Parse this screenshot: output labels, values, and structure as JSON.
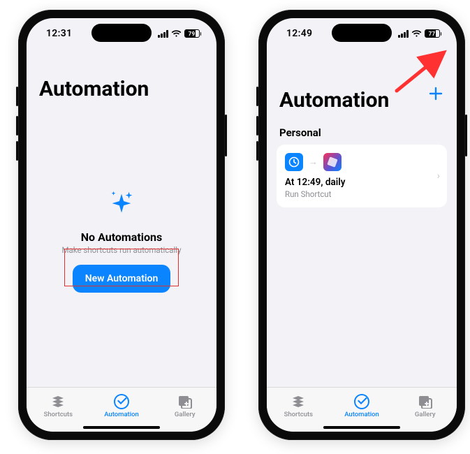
{
  "left": {
    "status": {
      "time": "12:31",
      "battery": "79"
    },
    "title": "Automation",
    "empty": {
      "heading": "No Automations",
      "subtitle": "Make shortcuts run automatically",
      "button": "New Automation"
    }
  },
  "right": {
    "status": {
      "time": "12:49",
      "battery": "77"
    },
    "title": "Automation",
    "section": "Personal",
    "automation": {
      "title": "At 12:49, daily",
      "subtitle": "Run Shortcut"
    }
  },
  "tabs": {
    "shortcuts": "Shortcuts",
    "automation": "Automation",
    "gallery": "Gallery"
  }
}
